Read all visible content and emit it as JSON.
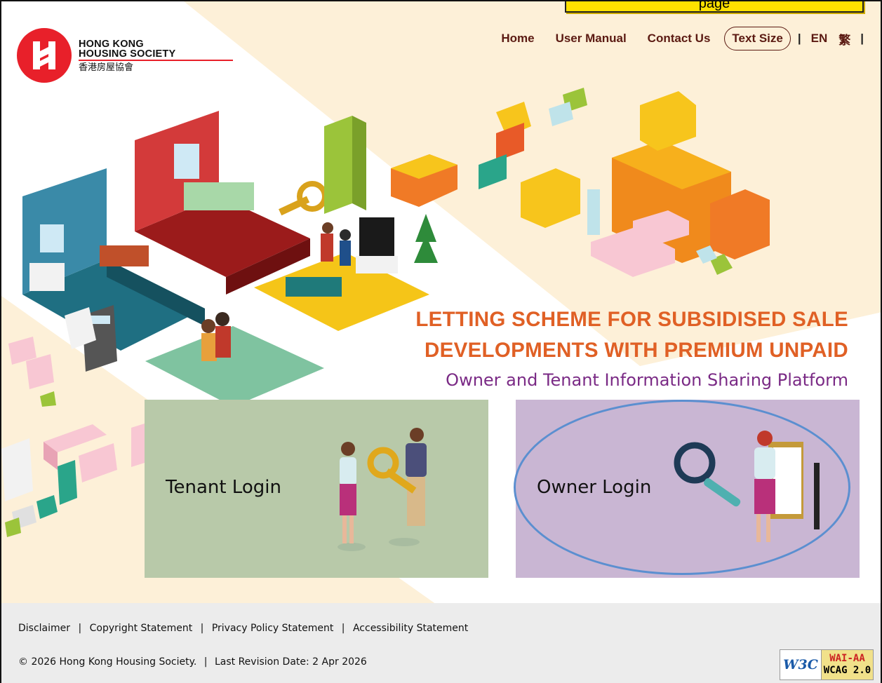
{
  "callout": {
    "text": "page"
  },
  "brand": {
    "name_line1": "HONG KONG",
    "name_line2": "HOUSING SOCIETY",
    "name_zh": "香港房屋協會",
    "color": "#e8202a"
  },
  "nav": {
    "home": "Home",
    "user_manual": "User Manual",
    "contact_us": "Contact Us",
    "text_size": "Text Size",
    "sep": "|",
    "lang_en": "EN",
    "lang_zh": "繁",
    "color": "#5b1a12"
  },
  "headline": {
    "line1": "LETTING SCHEME FOR SUBSIDISED SALE",
    "line2": "DEVELOPMENTS WITH PREMIUM UNPAID",
    "subtitle": "Owner and Tenant Information Sharing Platform",
    "title_color": "#e06025",
    "subtitle_color": "#7a2a85"
  },
  "cards": {
    "tenant_label": "Tenant Login",
    "owner_label": "Owner Login",
    "tenant_color": "#b8c9a9",
    "owner_color": "#c9b6d3"
  },
  "footer": {
    "disclaimer": "Disclaimer",
    "copyright": "Copyright Statement",
    "privacy": "Privacy Policy Statement",
    "accessibility": "Accessibility Statement",
    "sep": "|",
    "copy_text": "© 2026 Hong Kong Housing Society.",
    "revision": "Last Revision Date: 2 Apr 2026",
    "w3c_label": "W3C",
    "wai": "WAI-AA",
    "wcag": "WCAG 2.0"
  }
}
